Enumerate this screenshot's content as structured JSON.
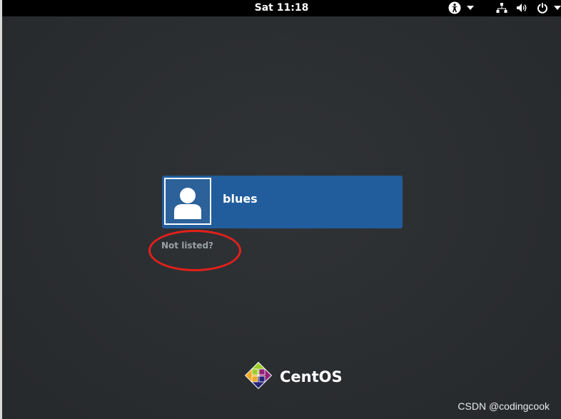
{
  "top_bar": {
    "clock": "Sat 11:18",
    "icons": [
      "accessibility-icon",
      "chevron-down-icon",
      "network-icon",
      "volume-icon",
      "power-icon",
      "chevron-down-icon"
    ]
  },
  "user_list": {
    "users": [
      {
        "name": "blues",
        "avatar": "default-user-avatar"
      }
    ],
    "not_listed_label": "Not listed?"
  },
  "branding": {
    "logo_text": "CentOS"
  },
  "watermark": {
    "text": "CSDN @codingcook"
  },
  "colors": {
    "background": "#2b2e31",
    "top_bar": "#000000",
    "user_card": "#215d9c",
    "annotation_circle": "#e3201b",
    "muted_text": "#9aa0a4"
  }
}
